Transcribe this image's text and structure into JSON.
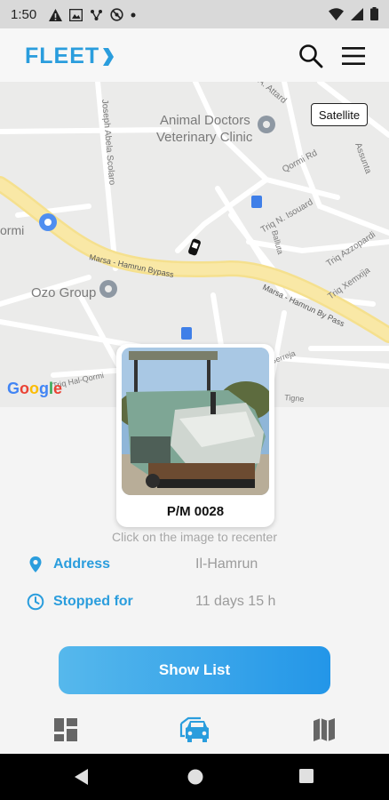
{
  "status_bar": {
    "time": "1:50",
    "icons_left": [
      "warning-icon",
      "gallery-icon",
      "network-icon",
      "location-off-icon",
      "dot-icon"
    ],
    "icons_right": [
      "wifi-icon",
      "signal-icon",
      "battery-icon"
    ]
  },
  "header": {
    "logo_text": "FLEET",
    "brand_color": "#2a9ddd"
  },
  "map": {
    "satellite_label": "Satellite",
    "google_label": "Google",
    "labels": {
      "animal_doctors_1": "Animal Doctors",
      "animal_doctors_2": "Veterinary Clinic",
      "ozo_group": "Ozo Group",
      "ormi": "ormi",
      "qormi_rd": "Qormi Rd",
      "triq_n_isouard": "Triq N. Isouard",
      "triq_azzopardi": "Triq Azzopardi",
      "triq_xemxija": "Triq Xemxija",
      "marsa_bypass_1": "Marsa - Hamrun Bypass",
      "marsa_bypass_2": "Marsa - Hamrun By Pass",
      "joseph_abela": "Joseph Abela Scolaro",
      "assunta": "Assunta",
      "attard": "A. Attard",
      "triq_hal_qormi": "Triq Hal-Qormi",
      "balluta": "Balluta",
      "cerrejs": "Gerreja",
      "tigne": "Tigne"
    }
  },
  "vehicle": {
    "name": "P/M 0028"
  },
  "hint": "Click on the image to recenter",
  "details": {
    "address_label": "Address",
    "address_value": "Il-Hamrun",
    "stopped_label": "Stopped for",
    "stopped_value": "11 days 15 h"
  },
  "show_list_label": "Show List",
  "bottom_nav": {
    "items": [
      "dashboard-icon",
      "vehicle-icon",
      "map-icon"
    ],
    "active_color": "#2a9ddd"
  }
}
